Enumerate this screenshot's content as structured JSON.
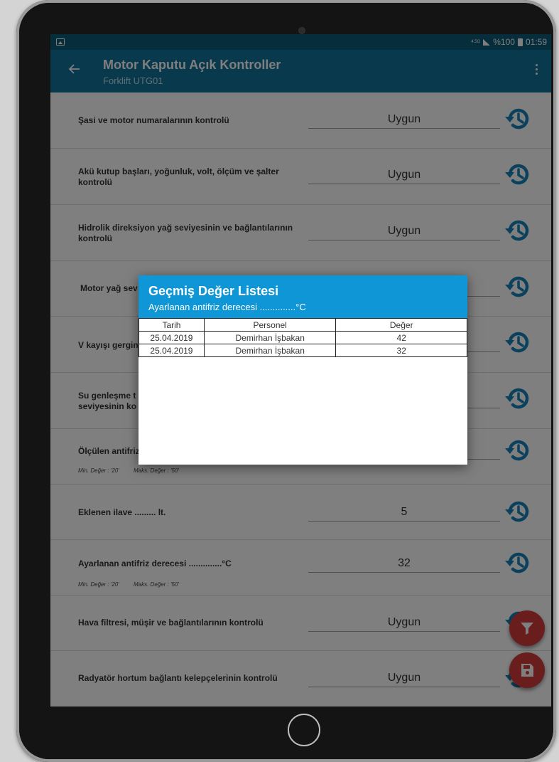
{
  "status_bar": {
    "network": "4.5G",
    "battery": "%100",
    "time": "01:59"
  },
  "app_bar": {
    "title": "Motor Kaputu Açık Kontroller",
    "subtitle": "Forklift UTG01"
  },
  "rows": [
    {
      "label": "Şasi ve motor numaralarının kontrolü",
      "value": "Uygun"
    },
    {
      "label": "Akü kutup başları, yoğunluk, volt, ölçüm ve şalter kontrolü",
      "value": "Uygun"
    },
    {
      "label": "Hidrolik direksiyon yağ seviyesinin ve bağlantılarının kontrolü",
      "value": "Uygun"
    },
    {
      "label": "Motor yağ sev",
      "value": ""
    },
    {
      "label": "V kayışı gergin",
      "value": ""
    },
    {
      "label": "Su genleşme t seviyesinin ko",
      "value": ""
    },
    {
      "label": "Ölçülen antifriz",
      "value": "",
      "min_note": "Min. Değer : '20'",
      "max_note": "Maks. Değer : '50'"
    },
    {
      "label": "Eklenen ilave ......... lt.",
      "value": "5"
    },
    {
      "label": "Ayarlanan antifriz derecesi ..............°C",
      "value": "32",
      "min_note": "Min. Değer : '20'",
      "max_note": "Maks. Değer : '50'"
    },
    {
      "label": "Hava filtresi, müşir ve bağlantılarının kontrolü",
      "value": "Uygun"
    },
    {
      "label": "Radyatör hortum bağlantı kelepçelerinin kontrolü",
      "value": "Uygun"
    }
  ],
  "dialog": {
    "title": "Geçmiş Değer Listesi",
    "subtitle": "Ayarlanan antifriz derecesi ..............°C",
    "columns": [
      "Tarih",
      "Personel",
      "Değer"
    ],
    "entries": [
      [
        "25.04.2019",
        "Demirhan İşbakan",
        "42"
      ],
      [
        "25.04.2019",
        "Demirhan İşbakan",
        "32"
      ]
    ]
  },
  "icons": {
    "back": "arrow-left-icon",
    "menu": "more-vert-icon",
    "history": "history-icon",
    "filter": "filter-icon",
    "save": "save-icon"
  },
  "colors": {
    "status_bar": "#0c5a78",
    "app_bar": "#11739a",
    "dialog_header": "#0f96d6",
    "history_icon": "#1682b8",
    "fab": "#d43a3a"
  }
}
